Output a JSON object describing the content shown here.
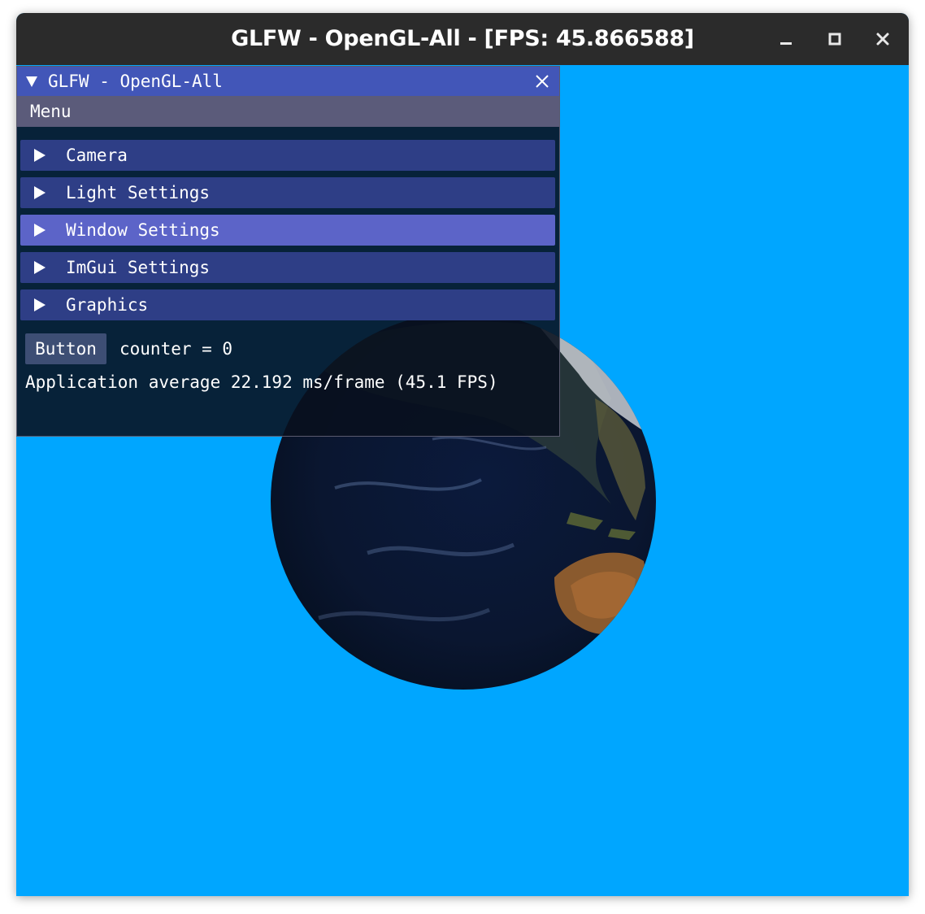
{
  "window": {
    "title": "GLFW - OpenGL-All - [FPS: 45.866588]",
    "background_color": "#00a6ff",
    "controls": [
      "minimize-icon",
      "maximize-icon",
      "close-icon"
    ]
  },
  "imgui": {
    "title": "GLFW - OpenGL-All",
    "menu": [
      "Menu"
    ],
    "headers": [
      {
        "label": "Camera",
        "highlighted": false
      },
      {
        "label": "Light Settings",
        "highlighted": false
      },
      {
        "label": "Window Settings",
        "highlighted": true
      },
      {
        "label": "ImGui Settings",
        "highlighted": false
      },
      {
        "label": "Graphics",
        "highlighted": false
      }
    ],
    "button_label": "Button",
    "counter_text": "counter = 0",
    "average_text": "Application average 22.192 ms/frame (45.1 FPS)",
    "colors": {
      "title_bg": "#4256b8",
      "menubar_bg": "#5b5b7a",
      "header_bg": "#2e3e86",
      "header_active_bg": "#5c64c8"
    }
  },
  "scene": {
    "object": "earth-globe"
  }
}
